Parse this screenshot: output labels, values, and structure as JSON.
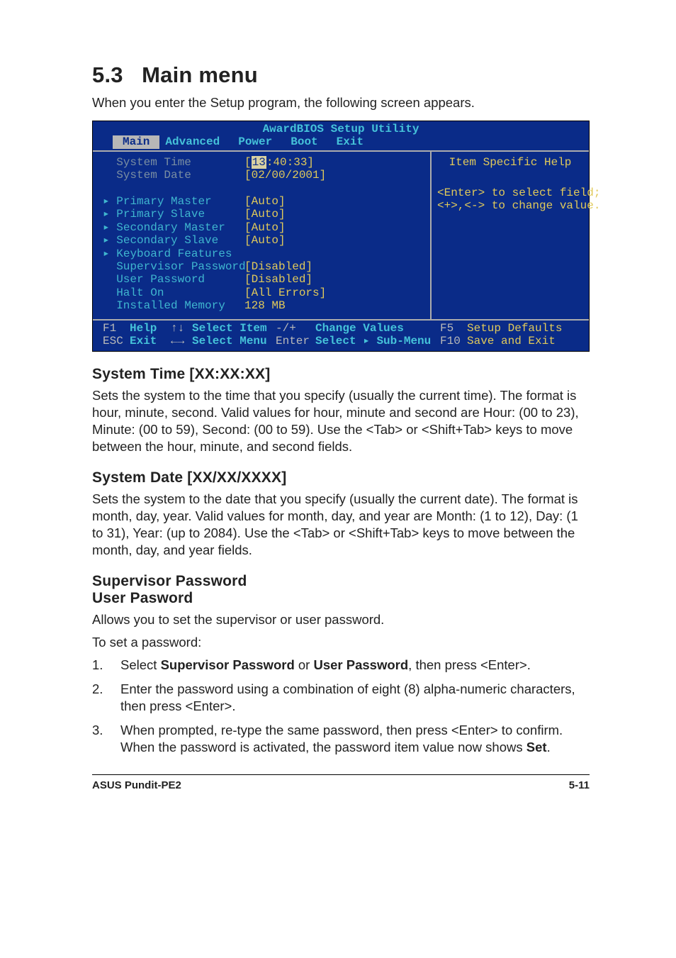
{
  "header": {
    "section_number": "5.3",
    "section_title": "Main menu",
    "intro": "When you enter the Setup program, the following screen appears."
  },
  "bios": {
    "title": "AwardBIOS Setup Utility",
    "tabs": [
      "Main",
      "Advanced",
      "Power",
      "Boot",
      "Exit"
    ],
    "left_rows": [
      {
        "label": "  System Time",
        "value_pre": "[",
        "cursor": "13",
        "value_post": ":40:33]",
        "dim": true
      },
      {
        "label": "  System Date",
        "value": "[02/00/2001]",
        "dim": true
      },
      {
        "label": "",
        "value": ""
      },
      {
        "label": "▸ Primary Master",
        "value": "[Auto]"
      },
      {
        "label": "▸ Primary Slave",
        "value": "[Auto]"
      },
      {
        "label": "▸ Secondary Master",
        "value": "[Auto]"
      },
      {
        "label": "▸ Secondary Slave",
        "value": "[Auto]"
      },
      {
        "label": "▸ Keyboard Features",
        "value": ""
      },
      {
        "label": "  Supervisor Password",
        "value": "[Disabled]"
      },
      {
        "label": "  User Password",
        "value": "[Disabled]"
      },
      {
        "label": "  Halt On",
        "value": "[All Errors]"
      },
      {
        "label": "  Installed Memory",
        "value": "128 MB"
      }
    ],
    "help_title": "Item Specific Help",
    "help_lines": [
      "<Enter> to select field;",
      "<+>,<-> to change value."
    ],
    "foot": {
      "l1": {
        "f1": "F1",
        "help": "Help",
        "arrows_v": "↑↓",
        "sel_item": "Select Item",
        "pm": "-/+",
        "chg": "Change Values",
        "f5": "F5",
        "def": "Setup Defaults"
      },
      "l2": {
        "esc": "ESC",
        "exit": "Exit",
        "arrows_h": "←→",
        "sel_menu": "Select Menu",
        "enter": "Enter",
        "sub": "Select ▸ Sub-Menu",
        "f10": "F10",
        "save": "Save and Exit"
      }
    }
  },
  "sections": {
    "system_time": {
      "heading": "System Time [XX:XX:XX]",
      "body": "Sets the system to the time that you specify (usually the current time). The format is hour, minute, second. Valid values for hour, minute and second are Hour: (00 to 23), Minute: (00 to 59), Second: (00 to 59). Use the <Tab> or <Shift+Tab> keys to move between the hour, minute, and second fields."
    },
    "system_date": {
      "heading": "System Date [XX/XX/XXXX]",
      "body": "Sets the system to the date that you specify (usually the current date). The format is month, day, year. Valid values for month, day, and year are Month: (1 to 12), Day: (1 to 31), Year: (up to 2084). Use the <Tab> or <Shift+Tab> keys to move between the month, day, and year fields."
    },
    "passwords": {
      "heading1": "Supervisor Password",
      "heading2": "User Pasword",
      "body1": "Allows you to set the supervisor or user password.",
      "body2": "To set a password:",
      "steps": {
        "n1": "1.",
        "s1_pre": "Select ",
        "s1_b1": "Supervisor Password",
        "s1_mid": " or ",
        "s1_b2": "User Password",
        "s1_post": ", then press <Enter>.",
        "n2": "2.",
        "s2": "Enter the password using a combination of eight (8) alpha-numeric characters, then press <Enter>.",
        "n3": "3.",
        "s3_pre": "When prompted, re-type the same password, then press <Enter> to confirm. When the password is activated, the password item value now shows ",
        "s3_b": "Set",
        "s3_post": "."
      }
    }
  },
  "footer": {
    "left": "ASUS Pundit-PE2",
    "right": "5-11"
  }
}
